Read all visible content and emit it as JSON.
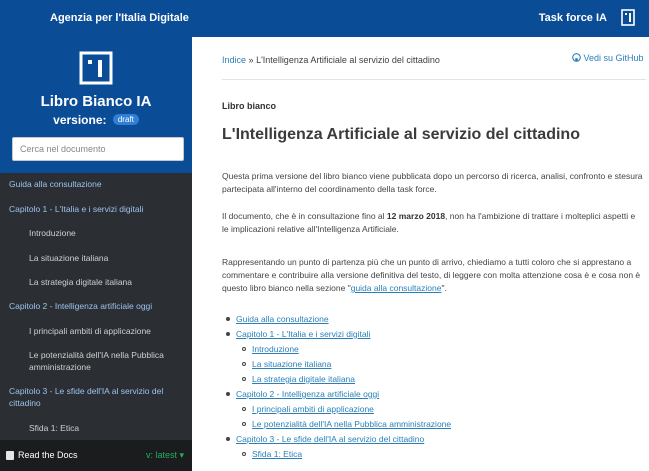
{
  "topbar": {
    "agency": "Agenzia per l'Italia Digitale",
    "task_force": "Task force IA"
  },
  "sidebar": {
    "title": "Libro Bianco IA",
    "version_label": "versione:",
    "badge": "draft",
    "search_placeholder": "Cerca nel documento",
    "items": [
      {
        "label": "Guida alla consultazione"
      },
      {
        "label": "Capitolo 1 - L'Italia e i servizi digitali"
      },
      {
        "label": "Introduzione"
      },
      {
        "label": "La situazione italiana"
      },
      {
        "label": "La strategia digitale italiana"
      },
      {
        "label": "Capitolo 2 - Intelligenza artificiale oggi"
      },
      {
        "label": "I principali ambiti di applicazione"
      },
      {
        "label": "Le potenzialità dell'IA nella Pubblica amministrazione"
      },
      {
        "label": "Capitolo 3 - Le sfide dell'IA al servizio del cittadino"
      },
      {
        "label": "Sfida 1: Etica"
      }
    ],
    "rtd_label": "Read the Docs",
    "rtd_version": "v: latest ▾"
  },
  "content": {
    "breadcrumb_home": "Indice",
    "breadcrumb_sep": "»",
    "breadcrumb_current": "L'Intelligenza Artificiale al servizio del cittadino",
    "github": "Vedi su GitHub",
    "section_label": "Libro bianco",
    "title": "L'Intelligenza Artificiale al servizio del cittadino",
    "p1": "Questa prima versione del libro bianco viene pubblicata dopo un percorso di ricerca, analisi, confronto e stesura partecipata all'interno del coordinamento della task force.",
    "p2_before": "Il documento, che è in consultazione fino al ",
    "p2_date": "12 marzo 2018",
    "p2_after": ", non ha l'ambizione di trattare i molteplici aspetti e le implicazioni relative all'Intelligenza Artificiale.",
    "p3_before": "Rappresentando un punto di partenza più che un punto di arrivo, chiediamo a tutti coloro che si apprestano a commentare e contribuire alla versione definitiva del testo, di leggere con molta attenzione cosa è e cosa non è questo libro bianco nella sezione \"",
    "p3_link": "guida alla consultazione",
    "p3_after": "\".",
    "toc": [
      {
        "label": "Guida alla consultazione"
      },
      {
        "label": "Capitolo 1 - L'Italia e i servizi digitali"
      },
      {
        "label": "Introduzione"
      },
      {
        "label": "La situazione italiana"
      },
      {
        "label": "La strategia digitale italiana"
      },
      {
        "label": "Capitolo 2 - Intelligenza artificiale oggi"
      },
      {
        "label": "I principali ambiti di applicazione"
      },
      {
        "label": "Le potenzialità dell'IA nella Pubblica amministrazione"
      },
      {
        "label": "Capitolo 3 - Le sfide dell'IA al servizio del cittadino"
      },
      {
        "label": "Sfida 1: Etica"
      }
    ]
  }
}
